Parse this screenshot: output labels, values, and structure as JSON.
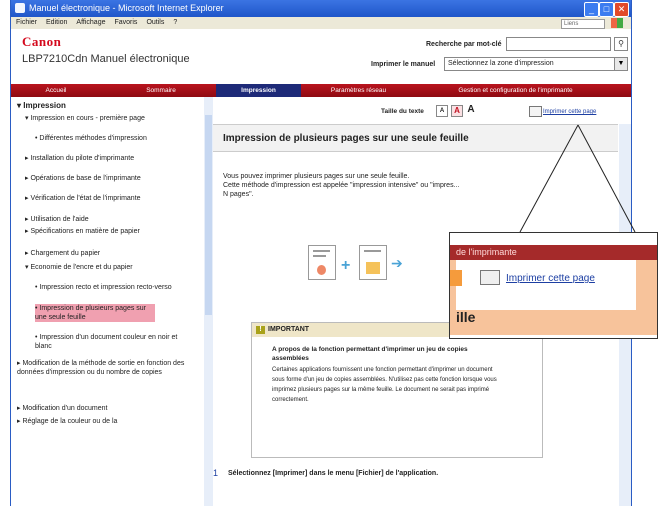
{
  "window": {
    "title": "Manuel électronique - Microsoft Internet Explorer",
    "min": "_",
    "max": "□",
    "close": "✕"
  },
  "menu": [
    "Fichier",
    "Edition",
    "Affichage",
    "Favoris",
    "Outils",
    "?"
  ],
  "links_label": "Liens",
  "header": {
    "brand": "Canon",
    "product": "LBP7210Cdn  Manuel électronique",
    "search_label": "Recherche par mot-clé",
    "print_label": "Imprimer le manuel",
    "print_select": "Sélectionnez la zone d'impression"
  },
  "nav": [
    {
      "label": "Accueil"
    },
    {
      "label": "Sommaire"
    },
    {
      "label": "Impression"
    },
    {
      "label": "Paramètres réseau"
    },
    {
      "label": "Gestion et configuration de l'imprimante"
    }
  ],
  "sidebar": {
    "items": [
      "Impression",
      "Impression en cours - première page",
      "Différentes méthodes d'impression",
      "Installation du pilote d'imprimante",
      "Opérations de base de l'imprimante",
      "Vérification de l'état de l'imprimante",
      "Utilisation de l'aide",
      "Spécifications en matière de papier",
      "Chargement du papier",
      "Economie de l'encre et du papier",
      "Impression recto et impression recto-verso",
      "Impression de plusieurs pages sur une seule feuille",
      "Impression d'un document couleur en noir et blanc",
      "Modification de la méthode de sortie en fonction des données d'impression ou du nombre de copies",
      "Modification d'un document",
      "Réglage de la couleur ou de la"
    ]
  },
  "content": {
    "text_size_label": "Taille du texte",
    "btn_small": "A",
    "btn_medium": "A",
    "btn_large": "A",
    "print_page_link": "Imprimer cette page",
    "title": "Impression de plusieurs pages sur une seule feuille",
    "para1": "Vous pouvez imprimer plusieurs pages sur une seule feuille.",
    "para2": "Cette méthode d'impression est appelée \"impression intensive\" ou \"impres... N pages\".",
    "important_title": "IMPORTANT",
    "important_icon": "!",
    "important_sub": "A propos de la fonction permettant d'imprimer un jeu de copies assemblées",
    "important_body": "Certaines applications fournissent une fonction permettant d'imprimer un document sous forme d'un jeu de copies assemblées. N'utilisez pas cette fonction lorsque vous imprimez plusieurs pages sur la même feuille. Le document ne serait pas imprimé correctement.",
    "step1_num": "1",
    "step1": "Sélectionnez [Imprimer] dans le menu [Fichier] de l'application."
  },
  "callout": {
    "strip": "de l'imprimante",
    "link": "Imprimer cette page",
    "tail": "ille"
  },
  "colors": {
    "brand_red": "#d4091d",
    "nav_red": "#b9141e",
    "nav_active": "#1e2a78",
    "link_blue": "#1d3fa3",
    "highlight": "#f0a0b0"
  }
}
